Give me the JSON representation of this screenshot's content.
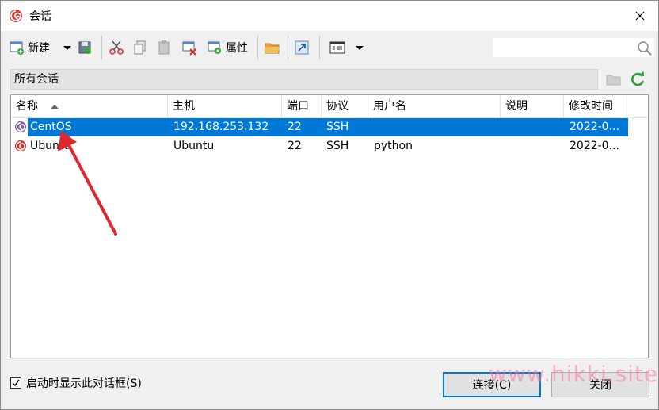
{
  "window": {
    "title": "会话",
    "close_glyph": "✕"
  },
  "toolbar": {
    "new_label": "新建",
    "properties_label": "属性",
    "search_placeholder": ""
  },
  "filter": {
    "label": "所有会话"
  },
  "list": {
    "columns": [
      "名称",
      "主机",
      "端口",
      "协议",
      "用户名",
      "说明",
      "修改时间"
    ],
    "rows": [
      {
        "name": "CentOS",
        "host": "192.168.253.132",
        "port": "22",
        "protocol": "SSH",
        "user": "",
        "desc": "",
        "modified": "2022-0...",
        "selected": true
      },
      {
        "name": "Ubuntu",
        "host": "Ubuntu",
        "port": "22",
        "protocol": "SSH",
        "user": "python",
        "desc": "",
        "modified": "2022-0...",
        "selected": false
      }
    ]
  },
  "footer": {
    "startup_checkbox_label": "启动时显示此对话框(S)",
    "startup_checked": true,
    "connect_label": "连接(C)",
    "close_label": "关闭"
  },
  "watermark": "www.hikki.site",
  "colors": {
    "selection": "#0078d7",
    "annotation_arrow": "#e0262e",
    "watermark": "#ff78aa"
  }
}
